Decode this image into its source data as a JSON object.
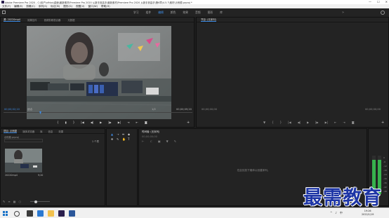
{
  "window": {
    "title": "Adobe Premiere Pro 2020 - C:\\用户\\xfhbo\\桌面\\最新素材\\Premiere Pro 2020 从新手到高手\\最新素材\\Premiere Pro 2020 从新手到高手\\第6章\\4.5.7\\素材\\示例原.prproj *",
    "controls": [
      "—",
      "☐",
      "✕"
    ]
  },
  "menubar": {
    "items": [
      "文件(F)",
      "编辑(E)",
      "剪辑(C)",
      "序列(S)",
      "标记(M)",
      "图形(G)",
      "视图(V)",
      "窗口(W)",
      "帮助(H)"
    ]
  },
  "workspace": {
    "tabs": [
      "学习",
      "组件",
      "编辑",
      "颜色",
      "效果",
      "音频",
      "图形",
      "库"
    ],
    "active": "编辑",
    "more": "»"
  },
  "source": {
    "tabs": [
      "源: 20220mp4",
      "效果控件",
      "音频剪辑混合器",
      "元数据"
    ],
    "left_tc": "00;00;02;10",
    "fit": "适合",
    "ratio": "1/2",
    "right_tc": "00;00;09;20",
    "transport": [
      "{",
      "▮",
      "}",
      "|◀",
      "◀|",
      "▶",
      "|▶",
      "▶|",
      "⇥",
      "⇤",
      "◙"
    ],
    "add": "+"
  },
  "program": {
    "tab": "节目: (无序列)",
    "left_tc": "00;00;00;00",
    "right_tc": "00;00;00;00",
    "transport": [
      "▼",
      "{",
      "}",
      "|◀",
      "◀|",
      "▶",
      "|▶",
      "▶|",
      "⇤",
      "⇥",
      "◙"
    ],
    "add": "+"
  },
  "project": {
    "tabs": [
      "项目: 示例原",
      "媒体浏览器",
      "库",
      "信息",
      "效果"
    ],
    "file": "示例原.prproj",
    "count": "1 个项",
    "clip_name": "20220mp4",
    "clip_dur": "9;20",
    "footer_icons": [
      "✎",
      "≡",
      "▦",
      "○"
    ]
  },
  "tools": {
    "icons": [
      "▲",
      "⇢",
      "⇹",
      "◆",
      "✥",
      "✎",
      "✋",
      "T"
    ]
  },
  "timeline": {
    "tab": "时间轴: (无序列)",
    "timecode": "00;00;00;00",
    "tools": [
      "⊢",
      "⊂",
      "▣",
      "▼",
      "✎"
    ],
    "empty_message": "在此处放下媒体以创建序列。"
  },
  "meter": {
    "db": [
      "0",
      "-6",
      "-12",
      "-18",
      "-24",
      "-30",
      "-36",
      "-42",
      "-48",
      "-54"
    ],
    "level_fraction": 0.9,
    "color": "#37b24d"
  },
  "watermark": {
    "text": "最需教育"
  },
  "taskbar": {
    "apps": [
      {
        "name": "task-view-icon",
        "color": "#3a3a3a"
      },
      {
        "name": "edge-icon",
        "color": "#2b79d1"
      },
      {
        "name": "folder-icon",
        "color": "#f2c14e"
      },
      {
        "name": "premiere-icon",
        "color": "#2a1f4d"
      },
      {
        "name": "word-icon",
        "color": "#2b579a"
      }
    ],
    "tray": [
      "^",
      "♪",
      "中"
    ],
    "time": "19:26",
    "date": "2022/1/19"
  },
  "colors": {
    "accent": "#3f8ee8",
    "watermark": "#1d35a6"
  }
}
